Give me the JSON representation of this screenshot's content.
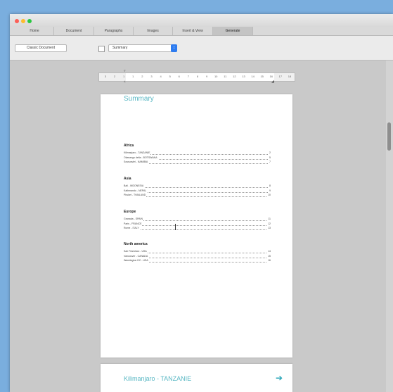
{
  "tabs": [
    "Home",
    "Document",
    "Paragraphs",
    "Images",
    "Insert & View",
    "Generate"
  ],
  "active_tab": "Generate",
  "toolbar": {
    "classic_button": "Classic Document",
    "toc_select_value": "Summary"
  },
  "ruler_numbers": [
    "3",
    "2",
    "1",
    "1",
    "2",
    "3",
    "4",
    "5",
    "6",
    "7",
    "8",
    "9",
    "10",
    "11",
    "12",
    "13",
    "14",
    "15",
    "16",
    "17",
    "18"
  ],
  "document": {
    "summary_title": "Summary",
    "regions": [
      {
        "name": "Africa",
        "entries": [
          {
            "text": "Kilimanjaro - TANZANIE",
            "page": "2"
          },
          {
            "text": "Okavango delta - BOTSWANA",
            "page": "5"
          },
          {
            "text": "Sossusvlei - NAMIBIA",
            "page": "7"
          }
        ]
      },
      {
        "name": "Asia",
        "entries": [
          {
            "text": "Bali - INDONESIA",
            "page": "8"
          },
          {
            "text": "Kathmandu - NEPAL",
            "page": "9"
          },
          {
            "text": "Phuket - THAILAND",
            "page": "10"
          }
        ]
      },
      {
        "name": "Europe",
        "entries": [
          {
            "text": "Granada - SPAIN",
            "page": "11"
          },
          {
            "text": "Paris - FRANCE",
            "page": "12"
          },
          {
            "text": "Rome - ITALY",
            "page": "13"
          }
        ]
      },
      {
        "name": "North america",
        "entries": [
          {
            "text": "San Francisco - USA",
            "page": "14"
          },
          {
            "text": "Vancouver - CANADA",
            "page": "15"
          },
          {
            "text": "Washington DC - USA",
            "page": "16"
          }
        ]
      }
    ],
    "next_page_title": "Kilimanjaro - TANZANIE"
  },
  "colors": {
    "accent": "#5ab8c4",
    "select_arrow": "#2d7cf0",
    "desktop": "#7aaede"
  }
}
